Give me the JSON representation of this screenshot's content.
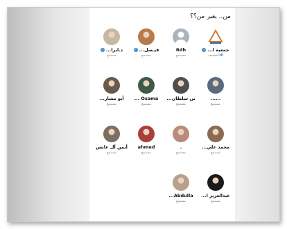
{
  "title": "من.. يغير من؟؟",
  "people": [
    {
      "name": "جمعية ا...",
      "sub": "المضيف",
      "badge": true,
      "host": true,
      "color": "#d9c9a2",
      "icon": "logo-icon"
    },
    {
      "name": "Rdh",
      "sub": "مستمع",
      "badge": false,
      "color": "#9aa3ad",
      "icon": "default-avatar-icon"
    },
    {
      "name": "فيـصل...",
      "sub": "مستمع",
      "badge": true,
      "color": "#b87a4b",
      "icon": "person-avatar"
    },
    {
      "name": "د.ابرا...",
      "sub": "مستمع",
      "badge": true,
      "color": "#c7b7a3",
      "icon": "person-avatar"
    },
    {
      "name": "......",
      "sub": "مستمع",
      "badge": false,
      "color": "#5b6a7c",
      "icon": "person-avatar"
    },
    {
      "name": "بن سلطان...",
      "sub": "مستمع",
      "badge": false,
      "color": "#4e4e4e",
      "icon": "person-avatar"
    },
    {
      "name": "Osama ...",
      "sub": "مستمع",
      "badge": false,
      "color": "#3f5a44",
      "icon": "person-avatar"
    },
    {
      "name": "أبو مشار...",
      "sub": "مستمع",
      "badge": false,
      "color": "#6b5a4a",
      "icon": "person-avatar"
    },
    {
      "name": "محمد علي...",
      "sub": "مستمع",
      "badge": false,
      "color": "#8a6a52",
      "icon": "person-avatar"
    },
    {
      "name": ".",
      "sub": "مستمع",
      "badge": false,
      "color": "#b88c7a",
      "icon": "person-avatar"
    },
    {
      "name": "ahmed",
      "sub": "مستمع",
      "badge": false,
      "color": "#a8403a",
      "icon": "person-avatar"
    },
    {
      "name": "أيمن آل عايس",
      "sub": "مستمع",
      "badge": false,
      "color": "#7a7060",
      "icon": "person-avatar"
    },
    {
      "name": "عبدالعزيز ا...",
      "sub": "مستمع",
      "badge": false,
      "color": "#1a1a1a",
      "icon": "person-avatar"
    },
    {
      "name": "Abdulla...",
      "sub": "مستمع",
      "badge": false,
      "color": "#b9a08a",
      "icon": "person-avatar"
    }
  ]
}
